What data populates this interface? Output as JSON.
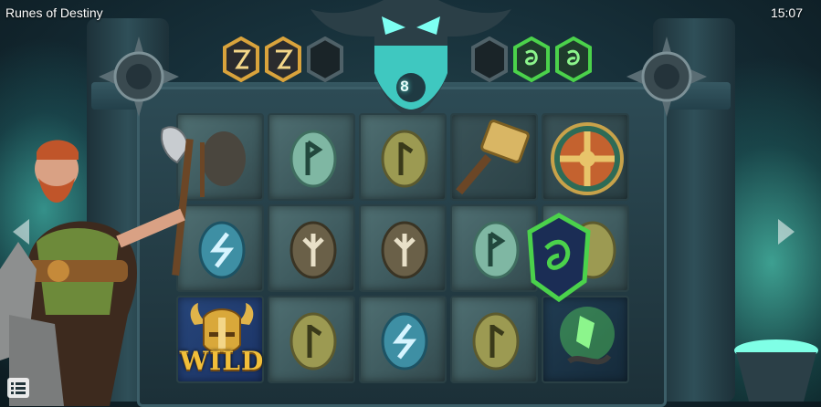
{
  "game": {
    "title": "Runes of Destiny",
    "clock": "15:07",
    "spin_counter": "8"
  },
  "meter": {
    "left_runes": [
      "gold-rune",
      "gold-rune",
      "empty-slot"
    ],
    "right_runes": [
      "empty-slot",
      "green-rune",
      "green-rune"
    ]
  },
  "reels": {
    "rows": [
      [
        "battle-axe",
        "rune-green-p",
        "rune-yellow-c",
        "golden-hammer",
        "round-shield"
      ],
      [
        "rune-blue-s",
        "rune-brown-y",
        "rune-brown-y",
        "rune-green-p",
        "rune-yellow-c"
      ],
      [
        "wild-viking-helmet",
        "rune-yellow-c",
        "rune-blue-s",
        "rune-yellow-c",
        "green-magic-rune"
      ]
    ],
    "wild_label": "WILD"
  },
  "controls": {
    "prev_icon": "chevron-left-icon",
    "next_icon": "chevron-right-icon",
    "menu_icon": "menu-list-icon"
  },
  "colors": {
    "glow": "#5ff5e5",
    "gold": "#f1bf3a",
    "green": "#4bd24b",
    "stone": "#4f6f72"
  }
}
